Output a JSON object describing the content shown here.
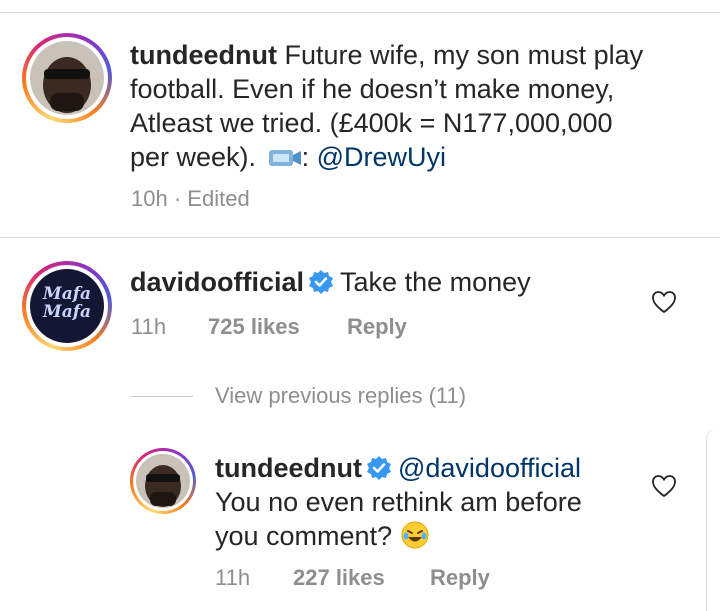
{
  "post_caption": {
    "username": "tundeednut",
    "line1": "Future wife, my son must play",
    "line2": "football. Even if he doesn’t make money,",
    "line3": "Atleast we tried. (£400k = N177,000,000",
    "line4_prefix": "per week).",
    "line4_sep": ":",
    "mention": "@DrewUyi",
    "time": "10h",
    "dot": "·",
    "edited": "Edited",
    "emoji_icon": "tv-camera-icon"
  },
  "comment": {
    "username": "davidoofficial",
    "text": "Take the money",
    "time": "11h",
    "likes": "725 likes",
    "reply_label": "Reply",
    "avatar_text_1": "Mafa",
    "avatar_text_2": "Mafa"
  },
  "view_previous": "View previous replies (11)",
  "reply": {
    "username": "tundeednut",
    "mention": "@davidoofficial",
    "line1": "You no even rethink am before",
    "line2": "you comment?",
    "emoji": "🤣",
    "time": "11h",
    "likes": "227 likes",
    "reply_label": "Reply"
  },
  "colors": {
    "text": "#262626",
    "secondary": "#8e8e8e",
    "mention": "#003569",
    "verified": "#3897f0"
  }
}
